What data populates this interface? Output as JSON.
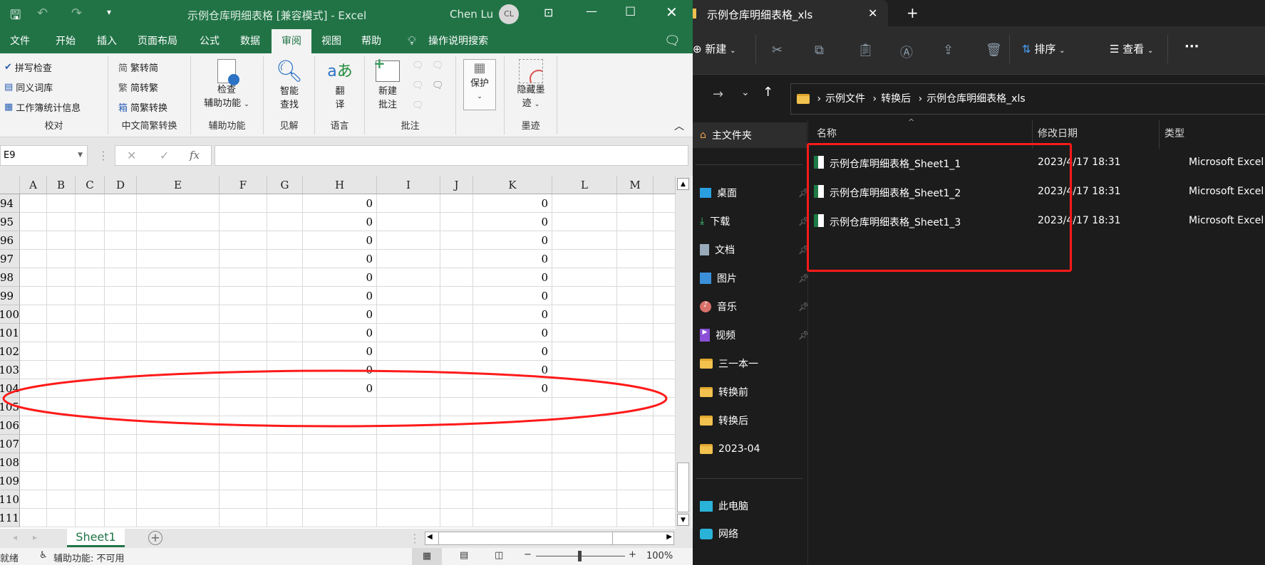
{
  "excel": {
    "title": "示例仓库明细表格  [兼容模式]  -  Excel",
    "user": "Chen Lu",
    "user_initials": "CL",
    "tabs": [
      "文件",
      "开始",
      "插入",
      "页面布局",
      "公式",
      "数据",
      "审阅",
      "视图",
      "帮助"
    ],
    "active_tab": "审阅",
    "search_label": "操作说明搜索",
    "ribbon": {
      "proofing": {
        "items": [
          "拼写检查",
          "同义词库",
          "工作簿统计信息"
        ],
        "label": "校对"
      },
      "chinese": {
        "items": [
          "繁转简",
          "简转繁",
          "简繁转换"
        ],
        "label": "中文简繁转换"
      },
      "accessibility": {
        "btn1": "检查",
        "btn2": "辅助功能",
        "label": "辅助功能"
      },
      "insights": {
        "btn1": "智能",
        "btn2": "查找",
        "label": "见解"
      },
      "language": {
        "btn1": "翻",
        "btn2": "译",
        "label": "语言"
      },
      "comments": {
        "btn1": "新建",
        "btn2": "批注",
        "label": "批注"
      },
      "protect": {
        "btn": "保护"
      },
      "ink": {
        "btn1": "隐藏墨",
        "btn2": "迹",
        "label": "墨迹"
      }
    },
    "name_box": "E9",
    "formula": "",
    "columns": [
      "A",
      "B",
      "C",
      "D",
      "E",
      "F",
      "G",
      "H",
      "I",
      "J",
      "K",
      "L",
      "M"
    ],
    "rows": [
      {
        "num": "94",
        "H": "0",
        "K": "0"
      },
      {
        "num": "95",
        "H": "0",
        "K": "0"
      },
      {
        "num": "96",
        "H": "0",
        "K": "0"
      },
      {
        "num": "97",
        "H": "0",
        "K": "0"
      },
      {
        "num": "98",
        "H": "0",
        "K": "0"
      },
      {
        "num": "99",
        "H": "0",
        "K": "0"
      },
      {
        "num": "100",
        "H": "0",
        "K": "0"
      },
      {
        "num": "101",
        "H": "0",
        "K": "0"
      },
      {
        "num": "102",
        "H": "0",
        "K": "0"
      },
      {
        "num": "103",
        "H": "0",
        "K": "0"
      },
      {
        "num": "104",
        "H": "0",
        "K": "0"
      },
      {
        "num": "105"
      },
      {
        "num": "106"
      },
      {
        "num": "107"
      },
      {
        "num": "108"
      },
      {
        "num": "109"
      },
      {
        "num": "110"
      },
      {
        "num": "111"
      }
    ],
    "sheet_tab": "Sheet1",
    "status": "就绪",
    "accessibility_status": "辅助功能: 不可用",
    "zoom": "100%",
    "annotation_color": "#ff1a1a",
    "accent": "#217346"
  },
  "explorer": {
    "tab_title": "示例仓库明细表格_xls",
    "toolbar": {
      "new": "新建",
      "sort": "排序",
      "view": "查看"
    },
    "breadcrumb": [
      "示例文件",
      "转换后",
      "示例仓库明细表格_xls"
    ],
    "nav": [
      "主文件夹",
      "桌面",
      "下载",
      "文档",
      "图片",
      "音乐",
      "视频",
      "三一本一",
      "转换前",
      "转换后",
      "2023-04",
      "此电脑",
      "网络"
    ],
    "headers": {
      "name": "名称",
      "date": "修改日期",
      "type": "类型"
    },
    "files": [
      {
        "name": "示例仓库明细表格_Sheet1_1",
        "date": "2023/4/17 18:31",
        "type": "Microsoft Excel"
      },
      {
        "name": "示例仓库明细表格_Sheet1_2",
        "date": "2023/4/17 18:31",
        "type": "Microsoft Excel"
      },
      {
        "name": "示例仓库明细表格_Sheet1_3",
        "date": "2023/4/17 18:31",
        "type": "Microsoft Excel"
      }
    ]
  }
}
